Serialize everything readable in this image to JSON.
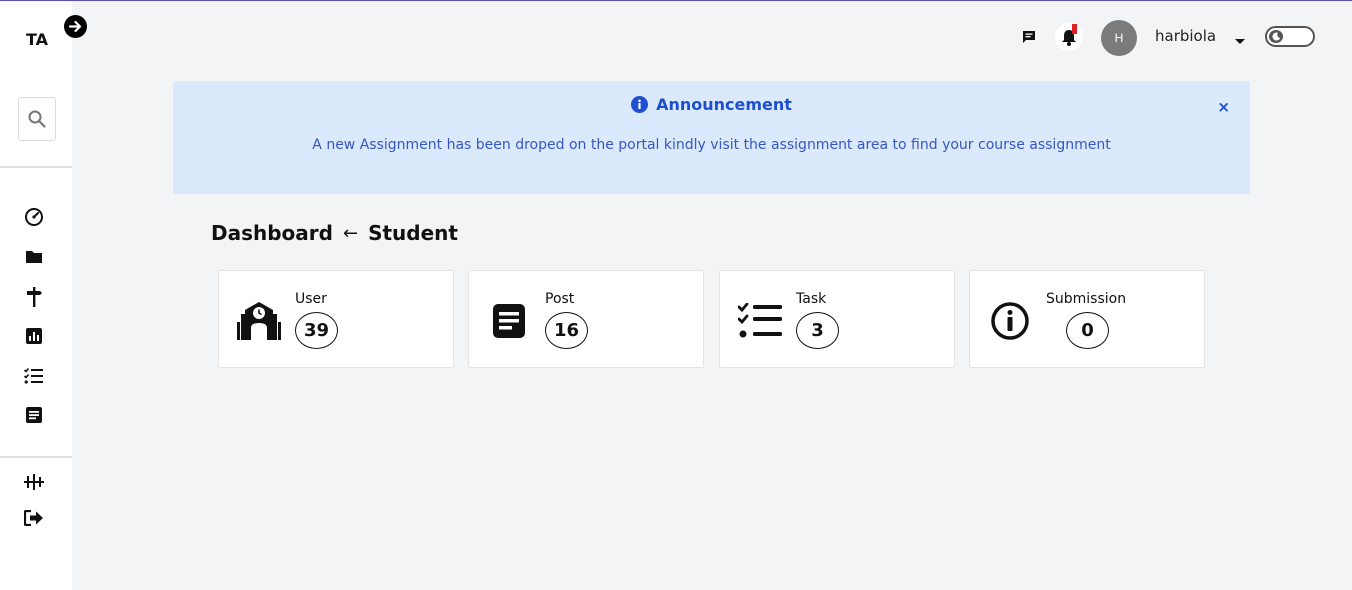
{
  "app": {
    "logo": "TA"
  },
  "topbar": {
    "avatar_initial": "H",
    "username": "harbiola"
  },
  "announcement": {
    "title": "Announcement",
    "body": "A new Assignment has been droped on the portal kindly visit the assignment area to find your course assignment",
    "close": "×"
  },
  "heading": {
    "section": "Dashboard",
    "arrow": "←",
    "sub": "Student"
  },
  "cards": [
    {
      "label": "User",
      "count": "39",
      "icon": "school-icon"
    },
    {
      "label": "Post",
      "count": "16",
      "icon": "post-icon"
    },
    {
      "label": "Task",
      "count": "3",
      "icon": "task-list-icon"
    },
    {
      "label": "Submission",
      "count": "0",
      "icon": "info-icon"
    }
  ],
  "sidebar": {
    "items": [
      {
        "icon": "dashboard-gauge-icon"
      },
      {
        "icon": "folder-icon"
      },
      {
        "icon": "signpost-icon"
      },
      {
        "icon": "chart-icon"
      },
      {
        "icon": "checklist-icon"
      },
      {
        "icon": "document-icon"
      },
      {
        "icon": "settings-sliders-icon"
      },
      {
        "icon": "logout-icon"
      }
    ]
  },
  "colors": {
    "announcement_bg": "#dbe9fc",
    "announcement_text": "#1d4fd0",
    "background": "#f3f4f6"
  }
}
